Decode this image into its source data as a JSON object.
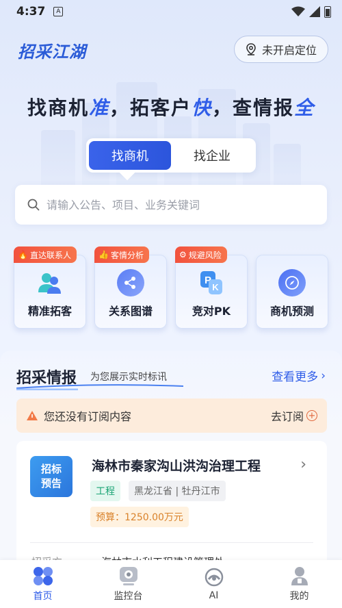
{
  "status_bar": {
    "time": "4:37"
  },
  "header": {
    "logo": "招采江湖",
    "location_label": "未开启定位"
  },
  "slogan": {
    "p1": "找商机",
    "a1": "准",
    "p2": "，拓客户",
    "a2": "快",
    "p3": "，查情报",
    "a3": "全"
  },
  "search_tabs": [
    {
      "label": "找商机"
    },
    {
      "label": "找企业"
    }
  ],
  "search": {
    "placeholder": "请输入公告、项目、业务关键词"
  },
  "features": [
    {
      "badge": "直达联系人",
      "label": "精准拓客",
      "icon": "contacts-icon"
    },
    {
      "badge": "客情分析",
      "label": "关系图谱",
      "icon": "graph-icon"
    },
    {
      "badge": "规避风险",
      "label": "竞对PK",
      "icon": "pk-icon"
    },
    {
      "label": "商机预测",
      "icon": "compass-icon"
    }
  ],
  "intel": {
    "title": "招采情报",
    "subtitle": "为您展示实时标讯",
    "see_more": "查看更多",
    "subscription": {
      "text": "您还没有订阅内容",
      "action": "去订阅"
    },
    "tender": {
      "tag_line1": "招标",
      "tag_line2": "预告",
      "title": "海林市秦家沟山洪沟治理工程",
      "type": "工程",
      "region": "黑龙江省 | 牡丹江市",
      "budget": "预算：1250.00万元",
      "row_label": "招采方",
      "row_value": "海林市水利工程建设管理处"
    }
  },
  "nav": [
    {
      "label": "首页",
      "icon": "home-icon",
      "active": true
    },
    {
      "label": "监控台",
      "icon": "monitor-icon",
      "active": false
    },
    {
      "label": "AI",
      "icon": "ai-icon",
      "active": false
    },
    {
      "label": "我的",
      "icon": "profile-icon",
      "active": false
    }
  ],
  "colors": {
    "primary": "#2f5de8",
    "badge": "#f2523e",
    "subscription_bg": "#fdecdc"
  }
}
